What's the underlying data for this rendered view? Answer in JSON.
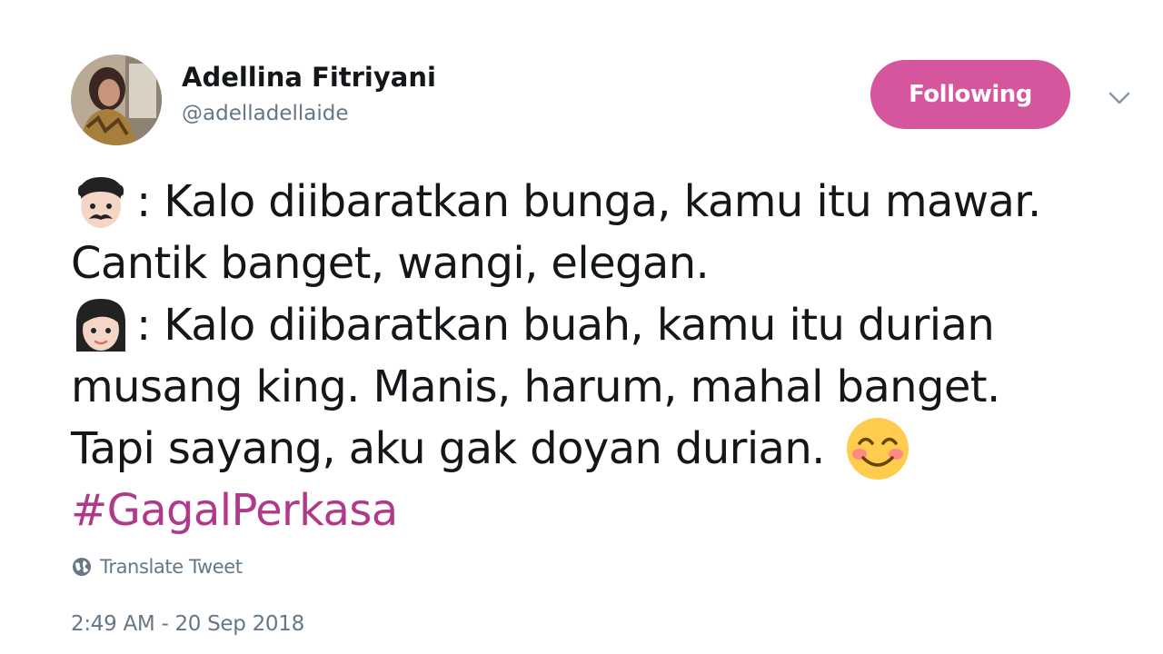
{
  "author": {
    "display_name": "Adellina Fitriyani",
    "handle": "@adelladellaide",
    "avatar_icon": "profile-photo"
  },
  "actions": {
    "follow_label": "Following",
    "follow_color": "#d6569e",
    "menu_icon": "chevron-down-icon"
  },
  "tweet": {
    "lines": [
      {
        "emoji": "man-mustache-emoji",
        "text": ": Kalo diibaratkan bunga, kamu itu mawar."
      },
      {
        "text": "Cantik banget, wangi, elegan."
      },
      {
        "emoji": "woman-emoji",
        "text": ": Kalo diibaratkan buah, kamu itu durian"
      },
      {
        "text": "musang king. Manis, harum, mahal banget."
      },
      {
        "text": "Tapi sayang, aku gak doyan durian.",
        "emoji_after": "smiling-face-emoji"
      }
    ],
    "hashtag": "#GagalPerkasa",
    "hashtag_color": "#b0398a"
  },
  "translate": {
    "label": "Translate Tweet",
    "icon": "globe-icon"
  },
  "timestamp": "2:49 AM - 20 Sep 2018"
}
